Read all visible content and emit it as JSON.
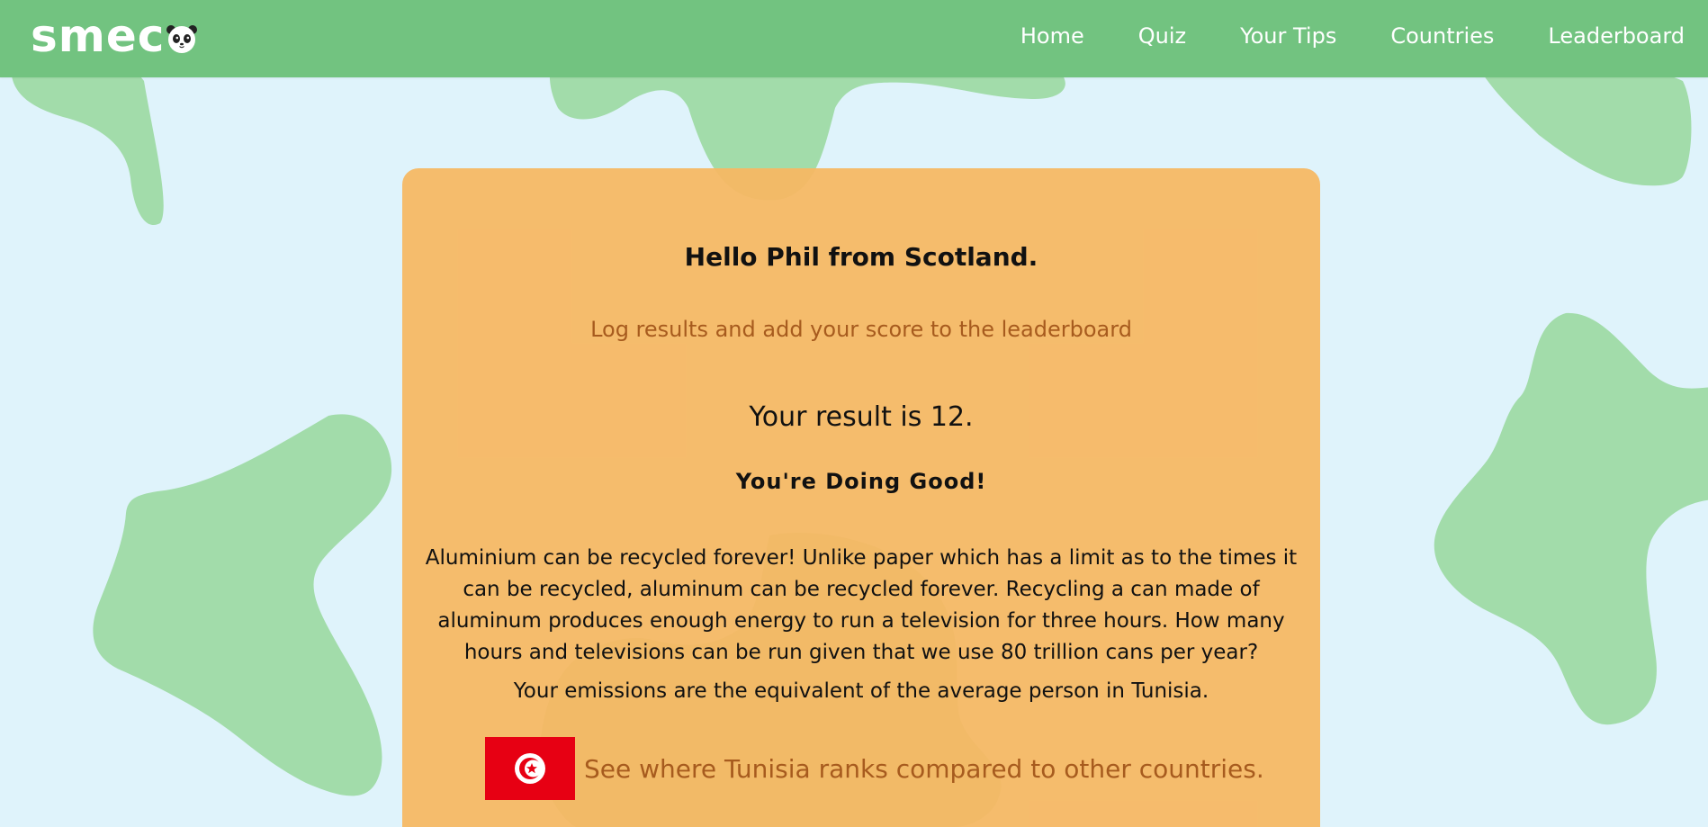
{
  "app": {
    "logo_text": "smec",
    "logo_icon": "panda-icon"
  },
  "nav": {
    "items": [
      {
        "label": "Home"
      },
      {
        "label": "Quiz"
      },
      {
        "label": "Your Tips"
      },
      {
        "label": "Countries"
      },
      {
        "label": "Leaderboard"
      }
    ]
  },
  "results": {
    "greeting": "Hello Phil from Scotland.",
    "log_link": "Log results and add your score to the leaderboard",
    "result_text": "Your result is 12.",
    "rating": "You're Doing Good!",
    "fact": "Aluminium can be recycled forever! Unlike paper which has a limit as to the times it can be recycled, aluminum can be recycled forever. Recycling a can made of aluminum produces enough energy to run a television for three hours. How many hours and televisions can be run given that we use 80 trillion cans per year?",
    "emissions_text": "Your emissions are the equivalent of the average person in Tunisia.",
    "country_link": "See where Tunisia ranks compared to other countries."
  },
  "colors": {
    "header": "#72c380",
    "background": "#dff3fb",
    "card": "#f7b863",
    "blob": "#a2dcaa",
    "link": "#a75b1e",
    "flag_red": "#e70013"
  },
  "icons": {
    "flag": "tunisia-flag-icon"
  }
}
